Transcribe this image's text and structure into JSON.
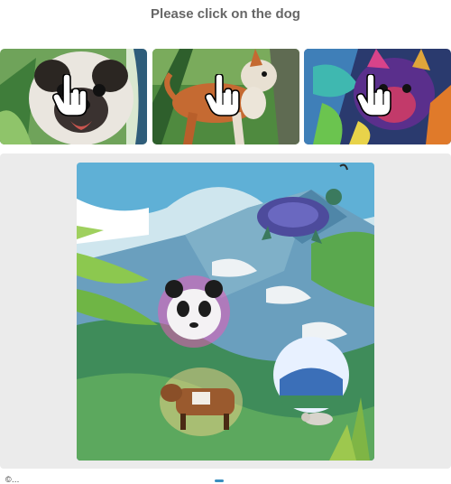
{
  "instruction": "Please click on the dog",
  "choices": [
    {
      "icon": "pointer-hand-icon",
      "subject": "pug dog portrait"
    },
    {
      "icon": "pointer-hand-icon",
      "subject": "brown and white dog"
    },
    {
      "icon": "pointer-hand-icon",
      "subject": "colorful dog"
    }
  ],
  "scene": {
    "animals": [
      "turtle",
      "panda",
      "cow",
      "small animal"
    ]
  },
  "footer": {
    "left_text": "©…"
  }
}
